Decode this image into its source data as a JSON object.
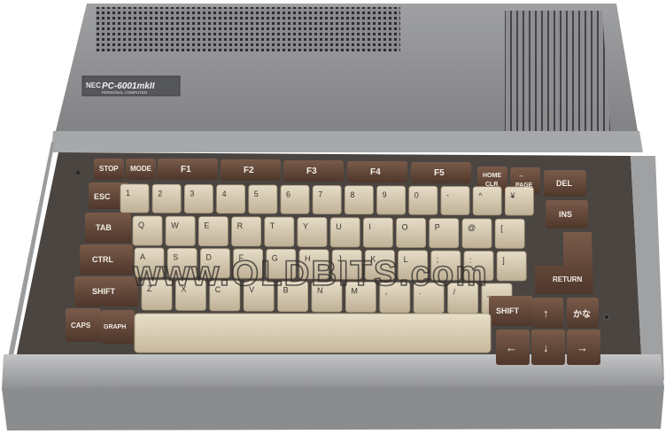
{
  "brand": {
    "maker": "NEC",
    "model": "PC-6001mkII",
    "subtitle": "PERSONAL COMPUTER"
  },
  "watermark": "www.OLDBITS.com",
  "keys": {
    "stop": "STOP",
    "mode": "MODE",
    "f1": "F1",
    "f2": "F2",
    "f3": "F3",
    "f4": "F4",
    "f5": "F5",
    "home_clr": [
      "HOME",
      "CLR"
    ],
    "page": "PAGE",
    "del": "DEL",
    "esc": "ESC",
    "ins": "INS",
    "tab": "TAB",
    "ctrl": "CTRL",
    "shift_left": "SHIFT",
    "return": "RETURN",
    "caps": "CAPS",
    "graph": "GRAPH",
    "shift_right": "SHIFT",
    "kana": "かな",
    "arrow_up": "↑",
    "arrow_down": "↓",
    "arrow_left": "←",
    "arrow_right": "→"
  },
  "row1": [
    "1",
    "2",
    "3",
    "4",
    "5",
    "6",
    "7",
    "8",
    "9",
    "0",
    "-",
    "^",
    "¥"
  ],
  "row2": [
    "Q",
    "W",
    "E",
    "R",
    "T",
    "Y",
    "U",
    "I",
    "O",
    "P",
    "@",
    "["
  ],
  "row3": [
    "A",
    "S",
    "D",
    "F",
    "G",
    "H",
    "J",
    "K",
    "L",
    ";",
    ":",
    "]"
  ],
  "row4": [
    "Z",
    "X",
    "C",
    "V",
    "B",
    "N",
    "M",
    ",",
    ".",
    "/",
    "_"
  ],
  "colors": {
    "case_top": "#8f9092",
    "case_light": "#b4b5b7",
    "keyboard_well": "#4a4541",
    "dark_key": "#6a4d3d",
    "light_key": "#d8cbb3"
  }
}
